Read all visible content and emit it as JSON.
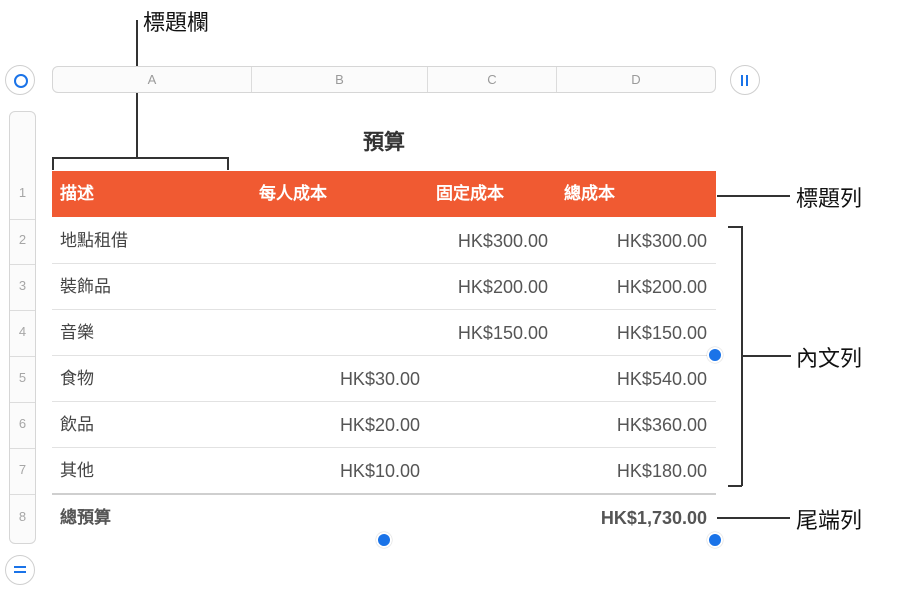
{
  "annotations": {
    "header_column": "標題欄",
    "header_row": "標題列",
    "body_rows": "內文列",
    "footer_row": "尾端列"
  },
  "columns": [
    "A",
    "B",
    "C",
    "D"
  ],
  "row_numbers": [
    "1",
    "2",
    "3",
    "4",
    "5",
    "6",
    "7",
    "8"
  ],
  "table": {
    "title": "預算",
    "headers": [
      "描述",
      "每人成本",
      "固定成本",
      "總成本"
    ],
    "rows": [
      {
        "desc": "地點租借",
        "per_person": "",
        "fixed": "HK$300.00",
        "total": "HK$300.00"
      },
      {
        "desc": "裝飾品",
        "per_person": "",
        "fixed": "HK$200.00",
        "total": "HK$200.00"
      },
      {
        "desc": "音樂",
        "per_person": "",
        "fixed": "HK$150.00",
        "total": "HK$150.00"
      },
      {
        "desc": "食物",
        "per_person": "HK$30.00",
        "fixed": "",
        "total": "HK$540.00"
      },
      {
        "desc": "飲品",
        "per_person": "HK$20.00",
        "fixed": "",
        "total": "HK$360.00"
      },
      {
        "desc": "其他",
        "per_person": "HK$10.00",
        "fixed": "",
        "total": "HK$180.00"
      }
    ],
    "footer": {
      "desc": "總預算",
      "total": "HK$1,730.00"
    }
  },
  "colors": {
    "header_fill": "#f05a32",
    "accent": "#1a73e8"
  },
  "icons": {
    "select_table": "circle-select-icon",
    "column_pause": "pause-icon",
    "row_add": "equals-icon"
  }
}
